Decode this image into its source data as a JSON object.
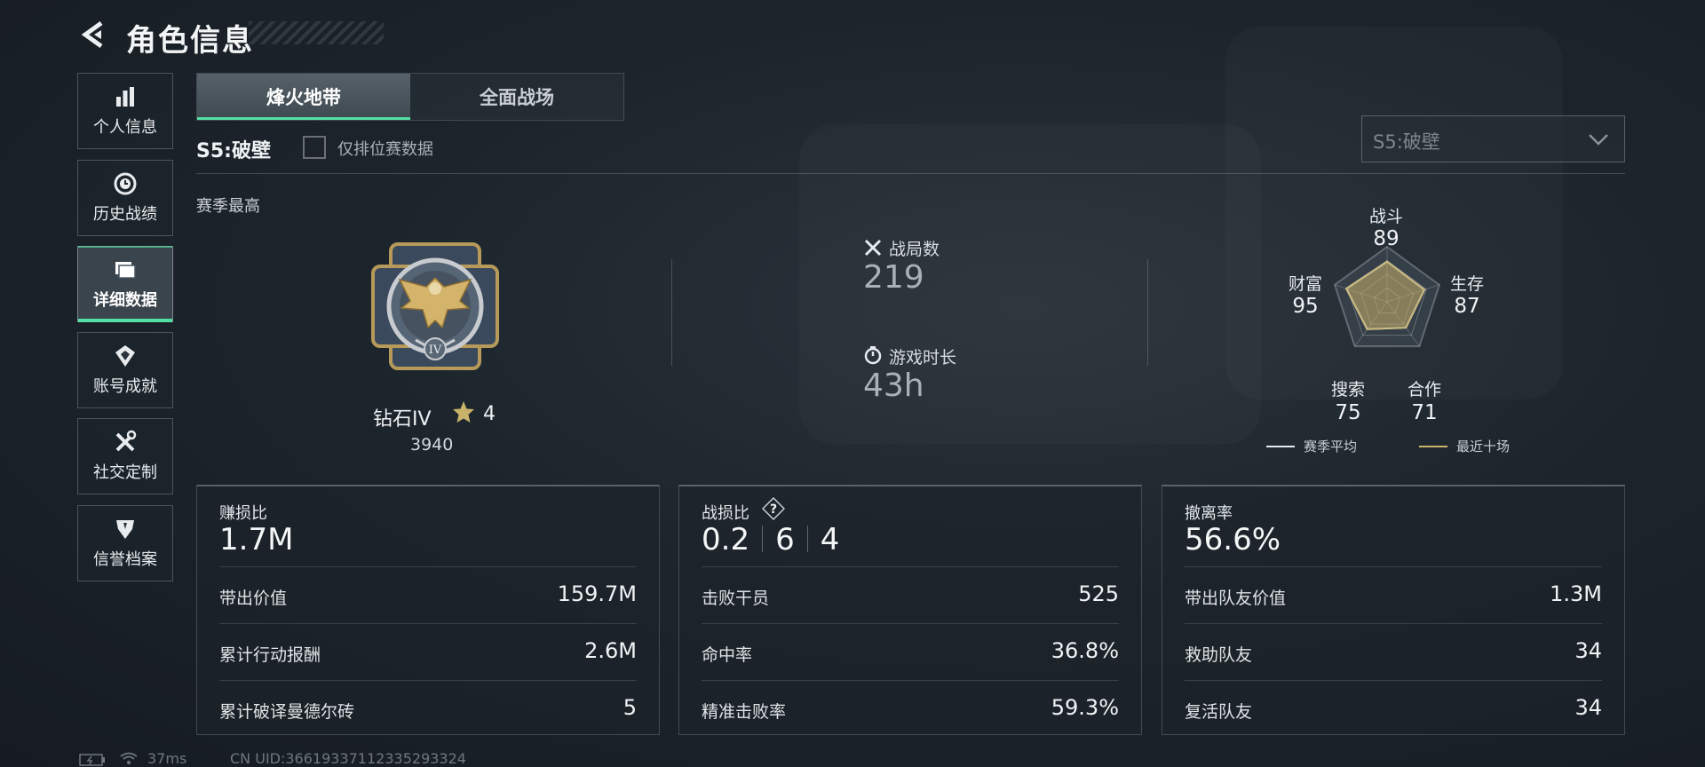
{
  "header": {
    "title": "角色信息"
  },
  "sidebar": {
    "items": [
      {
        "label": "个人信息",
        "icon": "bar-chart-icon"
      },
      {
        "label": "历史战绩",
        "icon": "history-icon"
      },
      {
        "label": "详细数据",
        "icon": "folder-icon",
        "active": true
      },
      {
        "label": "账号成就",
        "icon": "achievement-icon"
      },
      {
        "label": "社交定制",
        "icon": "tools-icon"
      },
      {
        "label": "信誉档案",
        "icon": "shield-icon"
      }
    ]
  },
  "tabs": [
    {
      "label": "烽火地带",
      "active": true
    },
    {
      "label": "全面战场",
      "active": false
    }
  ],
  "filter": {
    "season": "S5:破壁",
    "checkbox_label": "仅排位赛数据",
    "checked": false
  },
  "season_select": {
    "value": "S5:破壁"
  },
  "season_best": {
    "label": "赛季最高",
    "rank_name": "钻石IV",
    "stars": "4",
    "points": "3940",
    "medal_numeral": "IV"
  },
  "stats": {
    "matches_label": "战局数",
    "matches_value": "219",
    "playtime_label": "游戏时长",
    "playtime_value": "43h"
  },
  "radar": {
    "axes": [
      {
        "name": "战斗",
        "value": "89"
      },
      {
        "name": "生存",
        "value": "87"
      },
      {
        "name": "合作",
        "value": "71"
      },
      {
        "name": "搜索",
        "value": "75"
      },
      {
        "name": "财富",
        "value": "95"
      }
    ],
    "legend": [
      {
        "label": "赛季平均",
        "color": "#e6ebee"
      },
      {
        "label": "最近十场",
        "color": "#c9b36a"
      }
    ]
  },
  "cards": {
    "profit": {
      "title": "赚损比",
      "value": "1.7M",
      "rows": [
        {
          "label": "带出价值",
          "value": "159.7M"
        },
        {
          "label": "累计行动报酬",
          "value": "2.6M"
        },
        {
          "label": "累计破译曼德尔砖",
          "value": "5"
        }
      ]
    },
    "kd": {
      "title": "战损比",
      "ratio": [
        "0.2",
        "6",
        "4"
      ],
      "rows": [
        {
          "label": "击败干员",
          "value": "525"
        },
        {
          "label": "命中率",
          "value": "36.8%"
        },
        {
          "label": "精准击败率",
          "value": "59.3%"
        }
      ]
    },
    "extract": {
      "title": "撤离率",
      "value": "56.6%",
      "rows": [
        {
          "label": "带出队友价值",
          "value": "1.3M"
        },
        {
          "label": "救助队友",
          "value": "34"
        },
        {
          "label": "复活队友",
          "value": "34"
        }
      ]
    }
  },
  "footer": {
    "ping": "37ms",
    "uid": "CN UID:366193371123352933​24"
  },
  "colors": {
    "accent": "#52e0a4",
    "gold": "#c9b36a"
  }
}
